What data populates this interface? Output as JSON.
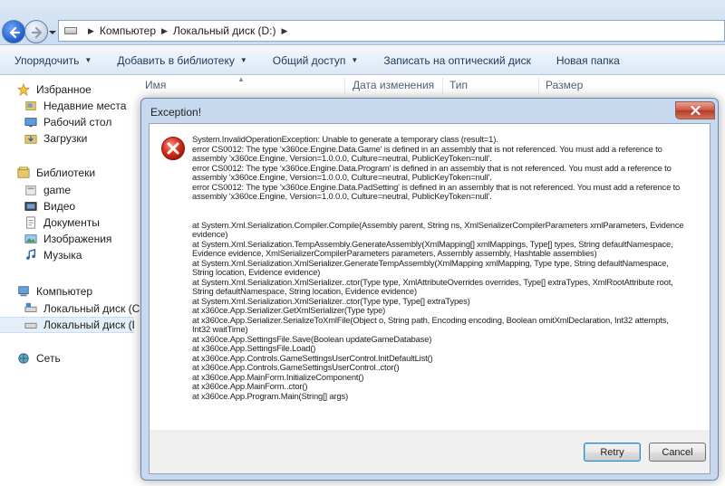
{
  "addressbar": {
    "breadcrumbs": [
      "Компьютер",
      "Локальный диск (D:)"
    ]
  },
  "toolbar": {
    "items": [
      "Упорядочить",
      "Добавить в библиотеку",
      "Общий доступ",
      "Записать на оптический диск",
      "Новая папка"
    ]
  },
  "sidebar": {
    "favorites": "Избранное",
    "recent": "Недавние места",
    "desktop": "Рабочий стол",
    "downloads": "Загрузки",
    "libraries": "Библиотеки",
    "game": "game",
    "video": "Видео",
    "documents": "Документы",
    "images": "Изображения",
    "music": "Музыка",
    "computer": "Компьютер",
    "drive_c": "Локальный диск (C:)",
    "drive_d": "Локальный диск (D:)",
    "network": "Сеть"
  },
  "columns": {
    "name": "Имя",
    "date": "Дата изменения",
    "type": "Тип",
    "size": "Размер"
  },
  "dialog": {
    "title": "Exception!",
    "message_lines": [
      "System.InvalidOperationException: Unable to generate a temporary class (result=1).",
      "error CS0012: The type 'x360ce.Engine.Data.Game' is defined in an assembly that is not referenced. You must add a reference to",
      "assembly 'x360ce.Engine, Version=1.0.0.0, Culture=neutral, PublicKeyToken=null'.",
      "error CS0012: The type 'x360ce.Engine.Data.Program' is defined in an assembly that is not referenced. You must add a reference to",
      "assembly 'x360ce.Engine, Version=1.0.0.0, Culture=neutral, PublicKeyToken=null'.",
      "error CS0012: The type 'x360ce.Engine.Data.PadSetting' is defined in an assembly that is not referenced. You must add a reference to",
      "assembly 'x360ce.Engine, Version=1.0.0.0, Culture=neutral, PublicKeyToken=null'.",
      "",
      "",
      "   at System.Xml.Serialization.Compiler.Compile(Assembly parent, String ns, XmlSerializerCompilerParameters xmlParameters, Evidence",
      "evidence)",
      "   at System.Xml.Serialization.TempAssembly.GenerateAssembly(XmlMapping[] xmlMappings, Type[] types, String defaultNamespace,",
      "Evidence evidence, XmlSerializerCompilerParameters parameters, Assembly assembly, Hashtable assemblies)",
      "   at System.Xml.Serialization.XmlSerializer.GenerateTempAssembly(XmlMapping xmlMapping, Type type, String defaultNamespace,",
      "String location, Evidence evidence)",
      "   at System.Xml.Serialization.XmlSerializer..ctor(Type type, XmlAttributeOverrides overrides, Type[] extraTypes, XmlRootAttribute root,",
      "String defaultNamespace, String location, Evidence evidence)",
      "   at System.Xml.Serialization.XmlSerializer..ctor(Type type, Type[] extraTypes)",
      "   at x360ce.App.Serializer.GetXmlSerializer(Type type)",
      "   at x360ce.App.Serializer.SerializeToXmlFile(Object o, String path, Encoding encoding, Boolean omitXmlDeclaration, Int32 attempts,",
      "Int32 waitTime)",
      "   at x360ce.App.SettingsFile.Save(Boolean updateGameDatabase)",
      "   at x360ce.App.SettingsFile.Load()",
      "   at x360ce.App.Controls.GameSettingsUserControl.InitDefaultList()",
      "   at x360ce.App.Controls.GameSettingsUserControl..ctor()",
      "   at x360ce.App.MainForm.InitializeComponent()",
      "   at x360ce.App.MainForm..ctor()",
      "   at x360ce.App.Program.Main(String[] args)"
    ],
    "retry_label": "Retry",
    "cancel_label": "Cancel"
  }
}
